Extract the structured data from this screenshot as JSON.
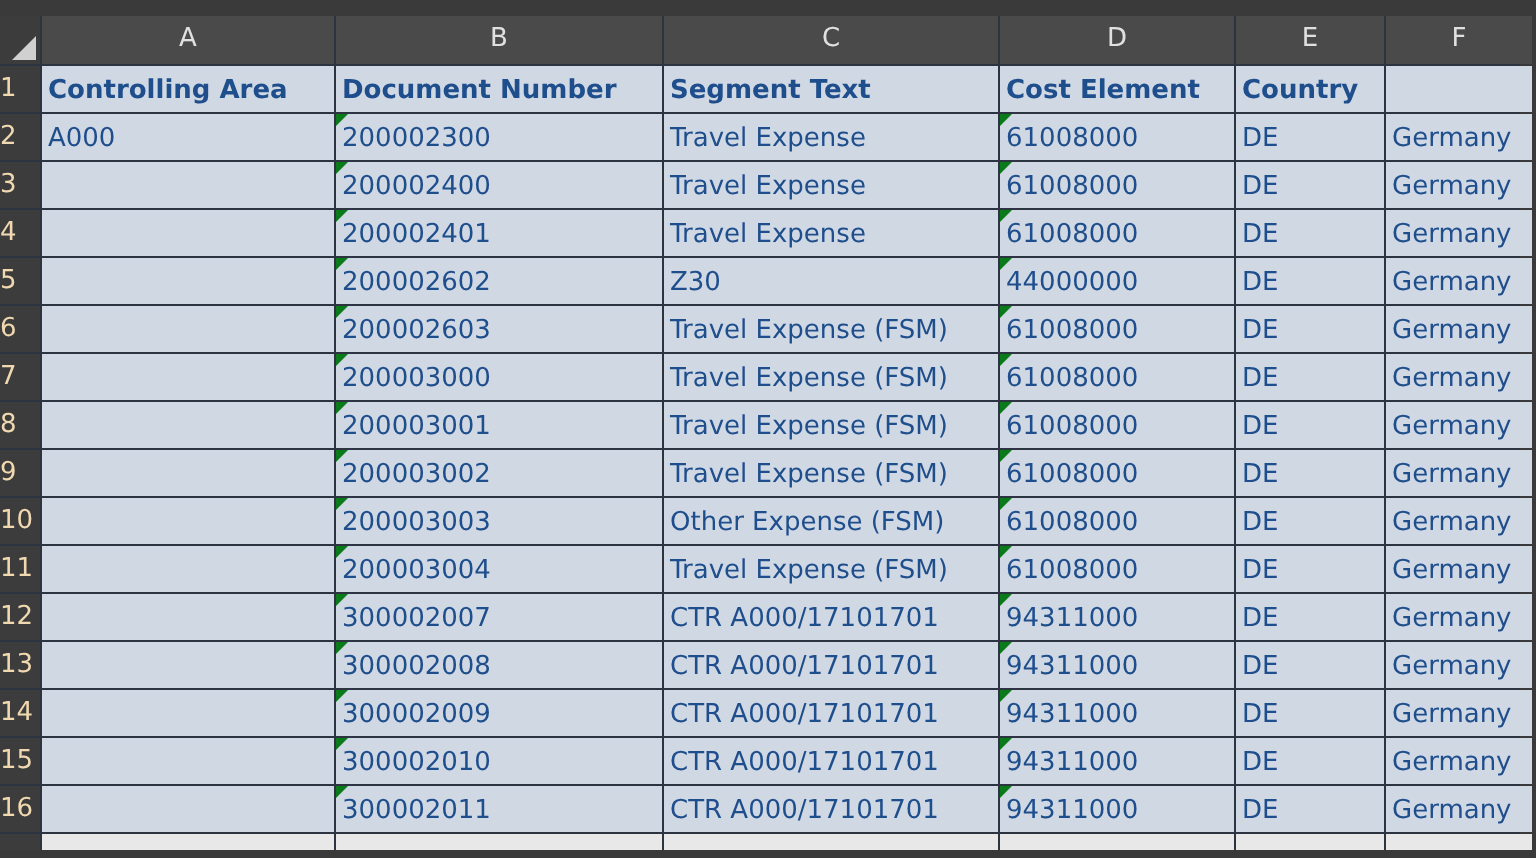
{
  "columns": [
    "A",
    "B",
    "C",
    "D",
    "E",
    "F"
  ],
  "rows": [
    {
      "number": "1",
      "kind": "header",
      "cells": [
        {
          "text": "Controlling Area",
          "flagged": false
        },
        {
          "text": "Document Number",
          "flagged": false
        },
        {
          "text": "Segment Text",
          "flagged": false
        },
        {
          "text": "Cost Element",
          "flagged": false
        },
        {
          "text": "Country",
          "flagged": false
        },
        {
          "flagged": false
        }
      ]
    },
    {
      "number": "2",
      "kind": "data",
      "cells": [
        {
          "text": "A000",
          "flagged": false
        },
        {
          "text": "200002300",
          "flagged": true
        },
        {
          "text": "Travel Expense",
          "flagged": false
        },
        {
          "text": "61008000",
          "flagged": true
        },
        {
          "text": "DE",
          "flagged": false
        },
        {
          "text": "Germany",
          "flagged": false
        }
      ]
    },
    {
      "number": "3",
      "kind": "data",
      "cells": [
        {
          "flagged": false
        },
        {
          "text": "200002400",
          "flagged": true
        },
        {
          "text": "Travel Expense",
          "flagged": false
        },
        {
          "text": "61008000",
          "flagged": true
        },
        {
          "text": "DE",
          "flagged": false
        },
        {
          "text": "Germany",
          "flagged": false
        }
      ]
    },
    {
      "number": "4",
      "kind": "data",
      "cells": [
        {
          "flagged": false
        },
        {
          "text": "200002401",
          "flagged": true
        },
        {
          "text": "Travel Expense",
          "flagged": false
        },
        {
          "text": "61008000",
          "flagged": true
        },
        {
          "text": "DE",
          "flagged": false
        },
        {
          "text": "Germany",
          "flagged": false
        }
      ]
    },
    {
      "number": "5",
      "kind": "data",
      "cells": [
        {
          "flagged": false
        },
        {
          "text": "200002602",
          "flagged": true
        },
        {
          "text": "Z30",
          "flagged": false
        },
        {
          "text": "44000000",
          "flagged": true
        },
        {
          "text": "DE",
          "flagged": false
        },
        {
          "text": "Germany",
          "flagged": false
        }
      ]
    },
    {
      "number": "6",
      "kind": "data",
      "cells": [
        {
          "flagged": false
        },
        {
          "text": "200002603",
          "flagged": true
        },
        {
          "text": "Travel Expense (FSM)",
          "flagged": false
        },
        {
          "text": "61008000",
          "flagged": true
        },
        {
          "text": "DE",
          "flagged": false
        },
        {
          "text": "Germany",
          "flagged": false
        }
      ]
    },
    {
      "number": "7",
      "kind": "data",
      "cells": [
        {
          "flagged": false
        },
        {
          "text": "200003000",
          "flagged": true
        },
        {
          "text": "Travel Expense (FSM)",
          "flagged": false
        },
        {
          "text": "61008000",
          "flagged": true
        },
        {
          "text": "DE",
          "flagged": false
        },
        {
          "text": "Germany",
          "flagged": false
        }
      ]
    },
    {
      "number": "8",
      "kind": "data",
      "cells": [
        {
          "flagged": false
        },
        {
          "text": "200003001",
          "flagged": true
        },
        {
          "text": "Travel Expense (FSM)",
          "flagged": false
        },
        {
          "text": "61008000",
          "flagged": true
        },
        {
          "text": "DE",
          "flagged": false
        },
        {
          "text": "Germany",
          "flagged": false
        }
      ]
    },
    {
      "number": "9",
      "kind": "data",
      "cells": [
        {
          "flagged": false
        },
        {
          "text": "200003002",
          "flagged": true
        },
        {
          "text": "Travel Expense (FSM)",
          "flagged": false
        },
        {
          "text": "61008000",
          "flagged": true
        },
        {
          "text": "DE",
          "flagged": false
        },
        {
          "text": "Germany",
          "flagged": false
        }
      ]
    },
    {
      "number": "10",
      "kind": "data",
      "cells": [
        {
          "flagged": false
        },
        {
          "text": "200003003",
          "flagged": true
        },
        {
          "text": "Other Expense (FSM)",
          "flagged": false
        },
        {
          "text": "61008000",
          "flagged": true
        },
        {
          "text": "DE",
          "flagged": false
        },
        {
          "text": "Germany",
          "flagged": false
        }
      ]
    },
    {
      "number": "11",
      "kind": "data",
      "cells": [
        {
          "flagged": false
        },
        {
          "text": "200003004",
          "flagged": true
        },
        {
          "text": "Travel Expense (FSM)",
          "flagged": false
        },
        {
          "text": "61008000",
          "flagged": true
        },
        {
          "text": "DE",
          "flagged": false
        },
        {
          "text": "Germany",
          "flagged": false
        }
      ]
    },
    {
      "number": "12",
      "kind": "data",
      "cells": [
        {
          "flagged": false
        },
        {
          "text": "300002007",
          "flagged": true
        },
        {
          "text": "CTR A000/17101701",
          "flagged": false
        },
        {
          "text": "94311000",
          "flagged": true
        },
        {
          "text": "DE",
          "flagged": false
        },
        {
          "text": "Germany",
          "flagged": false
        }
      ]
    },
    {
      "number": "13",
      "kind": "data",
      "cells": [
        {
          "flagged": false
        },
        {
          "text": "300002008",
          "flagged": true
        },
        {
          "text": "CTR A000/17101701",
          "flagged": false
        },
        {
          "text": "94311000",
          "flagged": true
        },
        {
          "text": "DE",
          "flagged": false
        },
        {
          "text": "Germany",
          "flagged": false
        }
      ]
    },
    {
      "number": "14",
      "kind": "data",
      "cells": [
        {
          "flagged": false
        },
        {
          "text": "300002009",
          "flagged": true
        },
        {
          "text": "CTR A000/17101701",
          "flagged": false
        },
        {
          "text": "94311000",
          "flagged": true
        },
        {
          "text": "DE",
          "flagged": false
        },
        {
          "text": "Germany",
          "flagged": false
        }
      ]
    },
    {
      "number": "15",
      "kind": "data",
      "cells": [
        {
          "flagged": false
        },
        {
          "text": "300002010",
          "flagged": true
        },
        {
          "text": "CTR A000/17101701",
          "flagged": false
        },
        {
          "text": "94311000",
          "flagged": true
        },
        {
          "text": "DE",
          "flagged": false
        },
        {
          "text": "Germany",
          "flagged": false
        }
      ]
    },
    {
      "number": "16",
      "kind": "data",
      "cells": [
        {
          "flagged": false
        },
        {
          "text": "300002011",
          "flagged": true
        },
        {
          "text": "CTR A000/17101701",
          "flagged": false
        },
        {
          "text": "94311000",
          "flagged": true
        },
        {
          "text": "DE",
          "flagged": false
        },
        {
          "text": "Germany",
          "flagged": false
        }
      ]
    }
  ]
}
